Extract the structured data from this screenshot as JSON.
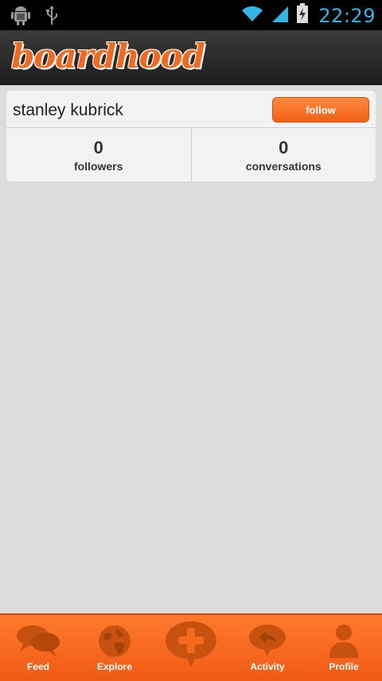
{
  "status_bar": {
    "time": "22:29",
    "icons": [
      "android-debug-icon",
      "usb-icon",
      "wifi-icon",
      "signal-icon",
      "battery-charging-icon"
    ]
  },
  "header": {
    "logo_text": "boardhood",
    "brand_color": "#f36a1e"
  },
  "profile": {
    "name": "stanley kubrick",
    "follow_label": "follow",
    "stats": [
      {
        "value": "0",
        "label": "followers"
      },
      {
        "value": "0",
        "label": "conversations"
      }
    ]
  },
  "bottom_nav": {
    "tabs": [
      {
        "label": "Feed",
        "icon": "chat-bubbles-icon"
      },
      {
        "label": "Explore",
        "icon": "globe-icon"
      },
      {
        "label": "",
        "icon": "add-bubble-icon"
      },
      {
        "label": "Activity",
        "icon": "reply-bubble-icon"
      },
      {
        "label": "Profile",
        "icon": "person-icon"
      }
    ],
    "accent": "#f36a1e"
  }
}
